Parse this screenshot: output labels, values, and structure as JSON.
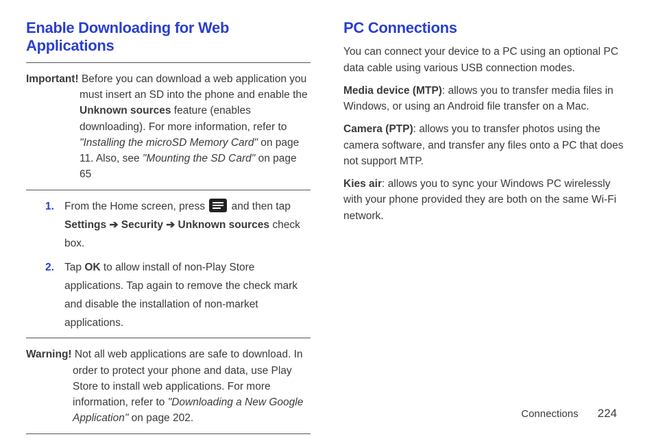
{
  "left": {
    "heading": "Enable Downloading for Web Applications",
    "important": {
      "lead": "Important!",
      "text_pre": " Before you can download a web application you must insert an SD into the phone and enable the ",
      "bold1": "Unknown sources",
      "text_mid1": " feature (enables downloading). For more information, refer to ",
      "ital1": "\"Installing the microSD Memory Card\"",
      "text_mid2": "  on page 11. Also, see ",
      "ital2": "\"Mounting the SD Card\"",
      "text_post": " on page 65"
    },
    "steps": {
      "s1": {
        "pre": "From the Home screen, press ",
        "post": " and then tap ",
        "b1": "Settings",
        "arr1": " ➔ ",
        "b2": "Security",
        "arr2": " ➔ ",
        "b3": "Unknown sources",
        "tail": " check box."
      },
      "s2": {
        "pre": "Tap ",
        "b1": "OK",
        "post": " to allow install of non-Play Store applications. Tap again to remove the check mark and disable the installation of non-market applications."
      }
    },
    "warning": {
      "lead": "Warning!",
      "text_pre": " Not all web applications are safe to download. In order to protect your phone and data, use Play Store to install web applications. For more information, refer to ",
      "ital1": "\"Downloading a New Google Application\"",
      "text_post": "  on page 202."
    }
  },
  "right": {
    "heading": "PC Connections",
    "intro": "You can connect your device to a PC using an optional PC data cable using various USB connection modes.",
    "mtp": {
      "lead": "Media device (MTP)",
      "text": ": allows you to transfer media files in Windows, or using an Android file transfer on a Mac."
    },
    "ptp": {
      "lead": "Camera (PTP)",
      "text": ": allows you to transfer photos using the camera software, and transfer any files onto a PC that does not support MTP."
    },
    "kies": {
      "lead": "Kies air",
      "text": ": allows you to sync your Windows PC wirelessly with your phone provided they are both on the same Wi-Fi network."
    }
  },
  "footer": {
    "section": "Connections",
    "page": "224"
  }
}
